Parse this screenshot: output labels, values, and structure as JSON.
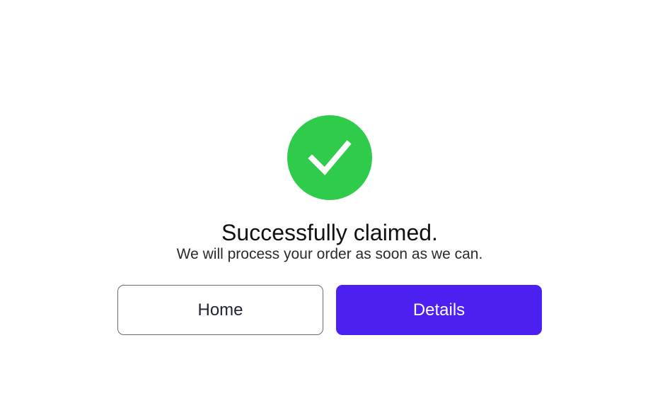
{
  "success": {
    "icon": "checkmark-icon",
    "color": "#2ecc4a",
    "title": "Successfully claimed.",
    "message": "We will process your order as soon as we can."
  },
  "actions": {
    "home_label": "Home",
    "details_label": "Details",
    "details_color": "#4c20f0"
  }
}
